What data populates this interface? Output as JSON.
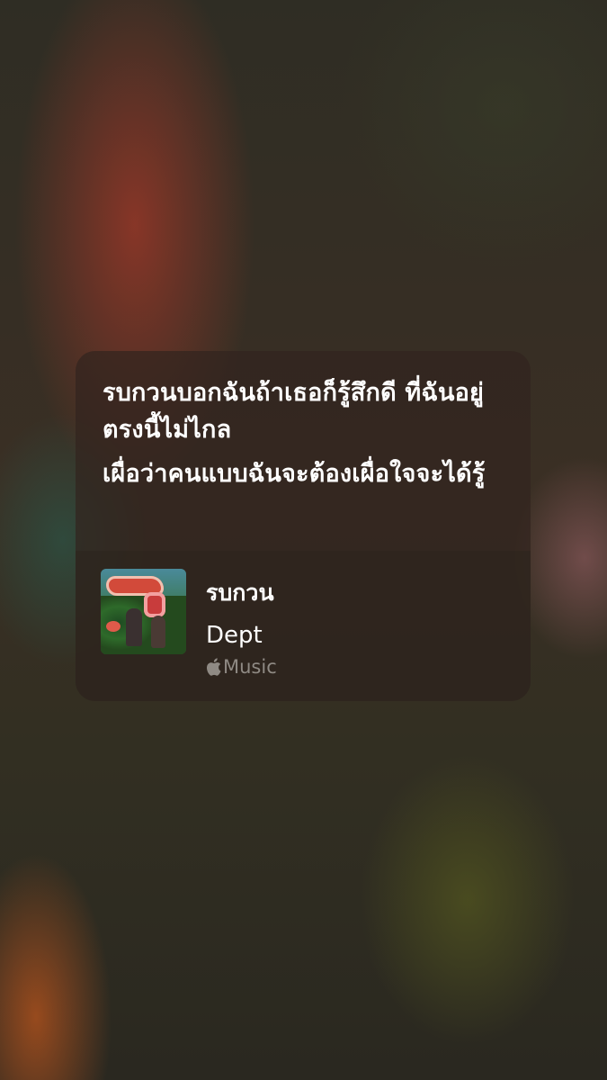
{
  "lyrics": {
    "lines": [
      "รบกวนบอกฉันถ้าเธอก็รู้สึกดี ที่ฉันอยู่ตรงนี้ไม่ไกล",
      "เผื่อว่าคนแบบฉันจะต้องเผื่อใจจะได้รู้"
    ]
  },
  "track": {
    "title": "รบกวน",
    "artist": "Dept",
    "service": {
      "icon": "apple-logo-icon",
      "label": "Music"
    }
  },
  "colors": {
    "card_background": "#32241e",
    "text_primary": "#ffffff",
    "text_secondary": "#8f8a84"
  }
}
